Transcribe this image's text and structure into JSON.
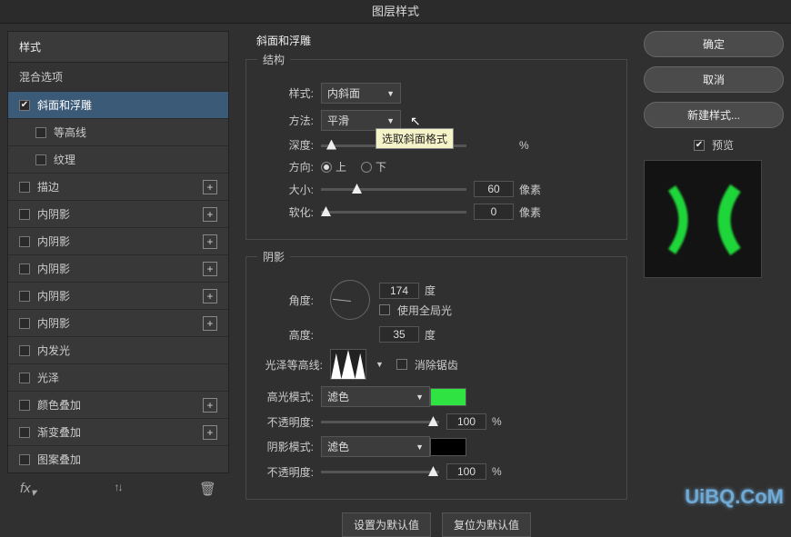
{
  "title": "图层样式",
  "left": {
    "styles_header": "样式",
    "blend_header": "混合选项",
    "bevel": "斜面和浮雕",
    "contour": "等高线",
    "texture": "纹理",
    "stroke": "描边",
    "inner_shadow": "内阴影",
    "inner_glow": "内发光",
    "satin": "光泽",
    "color_overlay": "颜色叠加",
    "gradient_overlay": "渐变叠加",
    "pattern_overlay": "图案叠加",
    "fx": "fx"
  },
  "center": {
    "panel_title": "斜面和浮雕",
    "struct": "结构",
    "style_lbl": "样式:",
    "style_val": "内斜面",
    "tech_lbl": "方法:",
    "tech_val": "平滑",
    "tooltip": "选取斜面格式",
    "depth_lbl": "深度:",
    "depth_unit": "%",
    "dir_lbl": "方向:",
    "dir_up": "上",
    "dir_down": "下",
    "size_lbl": "大小:",
    "size_val": "60",
    "size_unit": "像素",
    "soften_lbl": "软化:",
    "soften_val": "0",
    "soften_unit": "像素",
    "shading": "阴影",
    "angle_lbl": "角度:",
    "angle_val": "174",
    "angle_unit": "度",
    "global_light": "使用全局光",
    "altitude_lbl": "高度:",
    "altitude_val": "35",
    "altitude_unit": "度",
    "gloss_lbl": "光泽等高线:",
    "antialias": "消除锯齿",
    "hl_mode_lbl": "高光模式:",
    "hl_mode_val": "滤色",
    "hl_color": "#2fe343",
    "hl_opac_lbl": "不透明度:",
    "hl_opac_val": "100",
    "hl_opac_unit": "%",
    "sh_mode_lbl": "阴影模式:",
    "sh_mode_val": "滤色",
    "sh_color": "#000000",
    "sh_opac_lbl": "不透明度:",
    "sh_opac_val": "100",
    "sh_opac_unit": "%",
    "set_default": "设置为默认值",
    "reset_default": "复位为默认值"
  },
  "right": {
    "ok": "确定",
    "cancel": "取消",
    "new_style": "新建样式...",
    "preview": "预览"
  },
  "watermark": "UiBQ.CoM"
}
